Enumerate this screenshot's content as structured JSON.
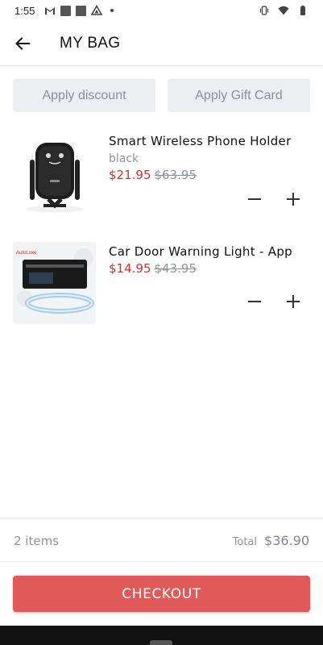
{
  "status_bar": {
    "time": "1:55",
    "left_icons": [
      "gmail-icon",
      "photo-icon",
      "photo-icon",
      "drive-icon",
      "dot-icon"
    ],
    "right_icons": [
      "vibrate-icon",
      "wifi-icon",
      "battery-icon"
    ]
  },
  "header": {
    "title": "MY BAG",
    "back_icon": "arrow-left-icon"
  },
  "actions": {
    "discount_label": "Apply discount",
    "gift_card_label": "Apply Gift Card"
  },
  "items": [
    {
      "name": "Smart Wireless Phone Holder",
      "variant": "black",
      "price": "$21.95",
      "original_price": "$63.95",
      "thumbnail_icon": "phone-holder-image"
    },
    {
      "name": "Car Door Warning Light - App",
      "price": "$14.95",
      "original_price": "$43.95",
      "thumbnail_icon": "door-light-image"
    }
  ],
  "summary": {
    "item_count": "2 items",
    "total_label": "Total",
    "total_value": "$36.90"
  },
  "checkout_label": "CHECKOUT",
  "colors": {
    "accent": "#e05a5a",
    "sale_price": "#d32f2f",
    "muted_text": "#8c94a0",
    "button_bg": "#eceff1"
  }
}
